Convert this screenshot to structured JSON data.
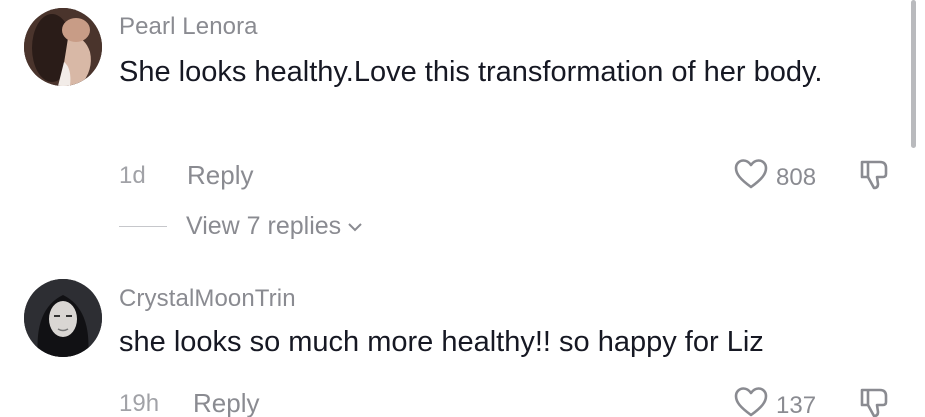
{
  "comments": [
    {
      "username": "Pearl Lenora",
      "text": "She looks healthy.Love this transformation of her body.",
      "time": "1d",
      "reply_label": "Reply",
      "likes": "808",
      "view_replies": "View 7 replies"
    },
    {
      "username": "CrystalMoonTrin",
      "text": "she looks so much more healthy!! so happy for Liz",
      "time": "19h",
      "reply_label": "Reply",
      "likes": "137"
    }
  ],
  "colors": {
    "text_primary": "#161823",
    "text_secondary": "#8a8b91",
    "icon": "#8a8b91"
  },
  "icons": [
    "heart-icon",
    "dislike-icon",
    "chevron-down-icon"
  ]
}
